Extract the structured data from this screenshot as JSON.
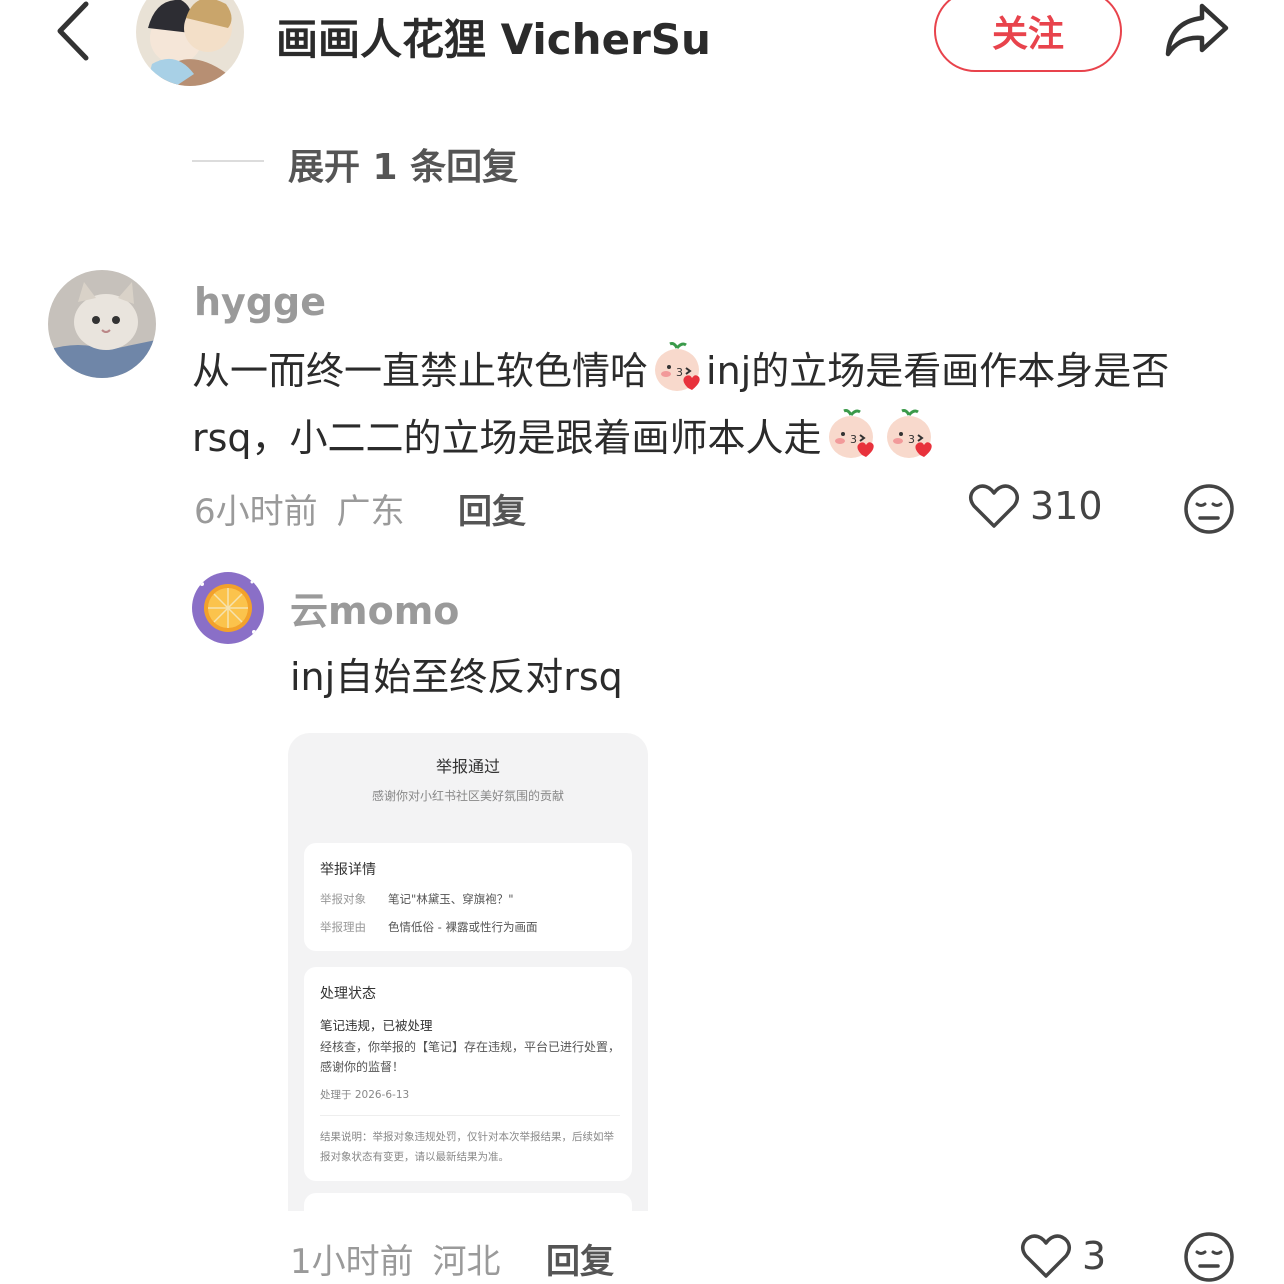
{
  "header": {
    "author_name": "画画人花狸 VicherSu",
    "follow_label": "关注"
  },
  "expand": {
    "label": "展开 1 条回复"
  },
  "comment1": {
    "user": "hygge",
    "text_part1": "从一而终一直禁止软色情哈",
    "text_part2": "inj的立场是看画作本身是否rsq，小二二的立场是跟着画师本人走",
    "time": "6小时前",
    "location": "广东",
    "reply_label": "回复",
    "likes": "310"
  },
  "comment2": {
    "user": "云momo",
    "text": "inj自始至终反对rsq",
    "time": "1小时前",
    "location": "河北",
    "reply_label": "回复",
    "likes": "3",
    "screenshot": {
      "title": "举报通过",
      "subtitle": "感谢你对小红书社区美好氛围的贡献",
      "details_heading": "举报详情",
      "target_key": "举报对象",
      "target_value": "笔记\"林黛玉、穿旗袍？\"",
      "reason_key": "举报理由",
      "reason_value": "色情低俗 - 裸露或性行为画面",
      "status_heading": "处理状态",
      "status_line": "笔记违规，已被处理",
      "status_desc": "经核查，你举报的【笔记】存在违规，平台已进行处置，感谢你的监督！",
      "processed_at": "处理于 2026-6-13",
      "result_note": "结果说明：举报对象违规处罚，仅针对本次举报结果，后续如举报对象状态有变更，请以最新结果为准。"
    }
  },
  "colors": {
    "accent": "#e8434c",
    "muted": "#9a9a9a",
    "text": "#2b2b2b"
  }
}
